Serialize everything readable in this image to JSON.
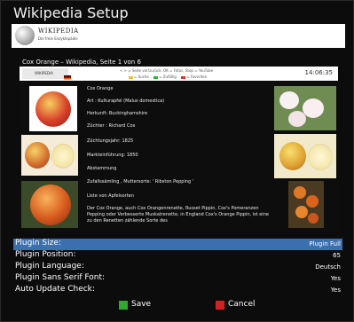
{
  "window": {
    "title": "Wikipedia Setup"
  },
  "banner": {
    "logo_text": "WIKIPEDIA",
    "logo_sub": "Die freie Enzyklopädie"
  },
  "preview": {
    "page_info": "Cox Orange – Wikipedia, Seite 1 von 6",
    "hint_line1": "< > = Seite vor/zurück, OK = Fotos, Stop = YouTube",
    "hint_suche": "= Suche",
    "hint_zufall": "= Zufällig",
    "hint_favoriten": "= Favoriten",
    "clock": "14:06:35",
    "article_title": "Cox Orange",
    "fields": [
      "Art :  Kulturapfel  (Malus domestica)",
      "Herkunft:  Buckinghamshire",
      "Züchter :  Richard Cox",
      "Züchtungsjahr: 1825",
      "Markteinführung: 1850",
      "Abstammung",
      "Zufallssämling , Muttersorte: ' Ribston Pepping '",
      "Liste von Apfelsorten"
    ],
    "description": "Der Cox Orange, auch Cox Orangenrenette, Russet Pippin, Cox's Pomeranzen Pepping oder Verbesserte Muskatrenette, in England Cox's Orange Pippin, ist eine zu den  Renetten  zählende Sorte des",
    "colors": {
      "red": "#e03030",
      "green": "#30b030",
      "yellow": "#f0c020"
    }
  },
  "settings": [
    {
      "label": "Plugin Size:",
      "value": "Plugin Full",
      "selected": true
    },
    {
      "label": "Plugin Position:",
      "value": "65"
    },
    {
      "label": "Plugin Language:",
      "value": "Deutsch"
    },
    {
      "label": "Plugin Sans Serif Font:",
      "value": "Yes"
    },
    {
      "label": "Auto Update Check:",
      "value": "Yes"
    }
  ],
  "buttons": {
    "save_label": "Save",
    "cancel_label": "Cancel",
    "save_color": "#2fa82f",
    "cancel_color": "#d42020"
  },
  "accent": "#3b6fb0"
}
